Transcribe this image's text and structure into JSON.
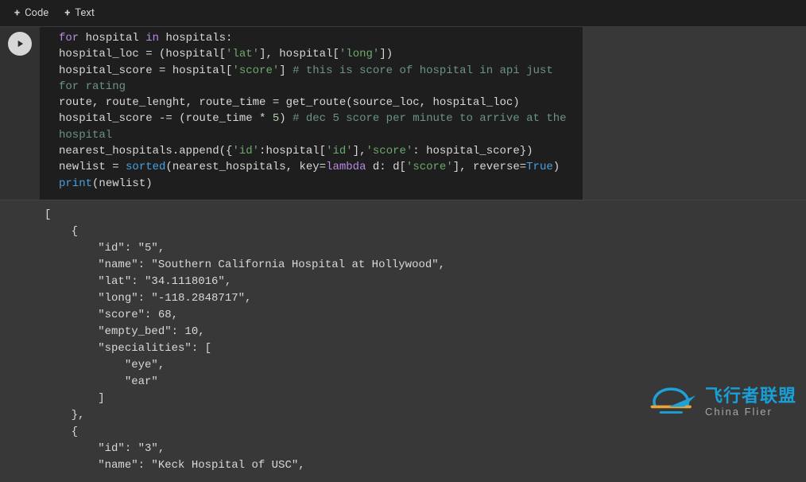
{
  "toolbar": {
    "code_label": "Code",
    "text_label": "Text"
  },
  "code": {
    "tokens": [
      [
        {
          "c": "kw",
          "t": "for"
        },
        {
          "c": "op",
          "t": " hospital "
        },
        {
          "c": "kw",
          "t": "in"
        },
        {
          "c": "op",
          "t": " hospitals:"
        }
      ],
      [
        {
          "c": "op",
          "t": "    hospital_loc = (hospital["
        },
        {
          "c": "str",
          "t": "'lat'"
        },
        {
          "c": "op",
          "t": "], hospital["
        },
        {
          "c": "str",
          "t": "'long'"
        },
        {
          "c": "op",
          "t": "])"
        }
      ],
      [
        {
          "c": "op",
          "t": "    hospital_score = hospital["
        },
        {
          "c": "str",
          "t": "'score'"
        },
        {
          "c": "op",
          "t": "] "
        },
        {
          "c": "cm",
          "t": "# this is score of hospital in api just for rating"
        }
      ],
      [
        {
          "c": "op",
          "t": "    route, route_lenght, route_time = get_route(source_loc, hospital_loc)"
        }
      ],
      [
        {
          "c": "op",
          "t": "    hospital_score -= (route_time * "
        },
        {
          "c": "num",
          "t": "5"
        },
        {
          "c": "op",
          "t": ") "
        },
        {
          "c": "cm",
          "t": "# dec 5 score per minute to arrive at the hospital"
        }
      ],
      [
        {
          "c": "op",
          "t": "    nearest_hospitals.append({"
        },
        {
          "c": "str",
          "t": "'id'"
        },
        {
          "c": "op",
          "t": ":hospital["
        },
        {
          "c": "str",
          "t": "'id'"
        },
        {
          "c": "op",
          "t": "],"
        },
        {
          "c": "str",
          "t": "'score'"
        },
        {
          "c": "op",
          "t": ": hospital_score})"
        }
      ],
      [
        {
          "c": "op",
          "t": "newlist = "
        },
        {
          "c": "fn",
          "t": "sorted"
        },
        {
          "c": "op",
          "t": "(nearest_hospitals, key="
        },
        {
          "c": "kw",
          "t": "lambda"
        },
        {
          "c": "op",
          "t": " d: d["
        },
        {
          "c": "str",
          "t": "'score'"
        },
        {
          "c": "op",
          "t": "], reverse="
        },
        {
          "c": "bool",
          "t": "True"
        },
        {
          "c": "op",
          "t": ")"
        }
      ],
      [
        {
          "c": "fn",
          "t": "print"
        },
        {
          "c": "op",
          "t": "(newlist)"
        }
      ]
    ]
  },
  "output_text": "[\n    {\n        \"id\": \"5\",\n        \"name\": \"Southern California Hospital at Hollywood\",\n        \"lat\": \"34.1118016\",\n        \"long\": \"-118.2848717\",\n        \"score\": 68,\n        \"empty_bed\": 10,\n        \"specialities\": [\n            \"eye\",\n            \"ear\"\n        ]\n    },\n    {\n        \"id\": \"3\",\n        \"name\": \"Keck Hospital of USC\",",
  "watermark": {
    "big": "飞行者联盟",
    "small": "China Flier"
  }
}
